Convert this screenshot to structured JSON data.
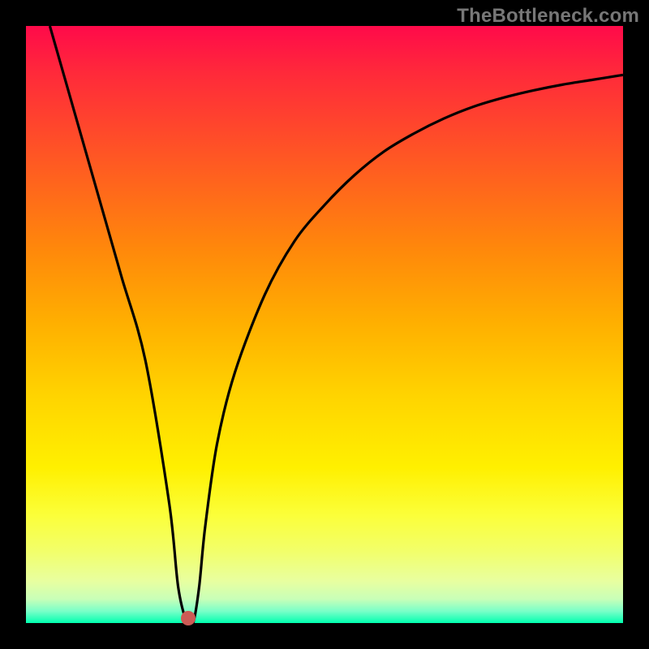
{
  "watermark": "TheBottleneck.com",
  "chart_data": {
    "type": "line",
    "title": "",
    "xlabel": "",
    "ylabel": "",
    "xlim": [
      0,
      100
    ],
    "ylim": [
      0,
      100
    ],
    "series": [
      {
        "name": "curve",
        "x": [
          4,
          8,
          12,
          16,
          20,
          24,
          25.5,
          27,
          28,
          29,
          30,
          32,
          35,
          40,
          45,
          50,
          55,
          60,
          65,
          70,
          75,
          80,
          85,
          90,
          95,
          100
        ],
        "values": [
          100,
          86,
          72,
          58,
          44,
          20,
          6,
          0,
          0,
          6,
          16,
          30,
          42,
          55,
          64,
          70,
          75,
          79,
          82,
          84.5,
          86.5,
          88,
          89.2,
          90.2,
          91,
          91.8
        ]
      }
    ],
    "marker": {
      "x": 27.2,
      "y": 0.8
    }
  },
  "colors": {
    "curve": "#000000",
    "marker": "#cc5a55"
  }
}
